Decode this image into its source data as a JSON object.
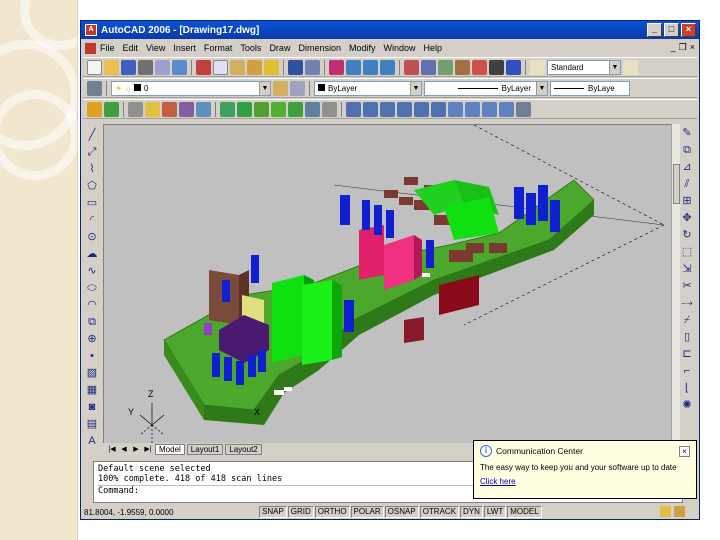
{
  "window": {
    "title": "AutoCAD 2006 - [Drawing17.dwg]",
    "app_icon": "autocad-logo-icon"
  },
  "menu": {
    "items": [
      "File",
      "Edit",
      "View",
      "Insert",
      "Format",
      "Tools",
      "Draw",
      "Dimension",
      "Modify",
      "Window",
      "Help"
    ]
  },
  "toolbars": {
    "text_style": "Standard",
    "layer": "0",
    "color": "ByLayer",
    "linetype": "ByLayer",
    "lineweight": "ByLaye"
  },
  "layout_tabs": {
    "tabs": [
      "Model",
      "Layout1",
      "Layout2"
    ],
    "active": "Model"
  },
  "ucs": {
    "x_label": "X",
    "y_label": "Y",
    "z_label": "Z"
  },
  "command_window": {
    "lines": [
      "Default scene selected",
      "100% complete. 418 of 418 scan lines"
    ],
    "prompt": "Command:"
  },
  "status_bar": {
    "coordinates": "81.8004, -1.9559, 0.0000",
    "toggles": [
      "SNAP",
      "GRID",
      "ORTHO",
      "POLAR",
      "OSNAP",
      "OTRACK",
      "DYN",
      "LWT",
      "MODEL"
    ]
  },
  "communication_center": {
    "title": "Communication Center",
    "message": "The easy way to keep you and your software up to date",
    "link": "Click here"
  },
  "colors": {
    "viewport_bg": "#c0c0c0",
    "board_green": "#4ca82c",
    "title_bar": "#0a46c8"
  }
}
